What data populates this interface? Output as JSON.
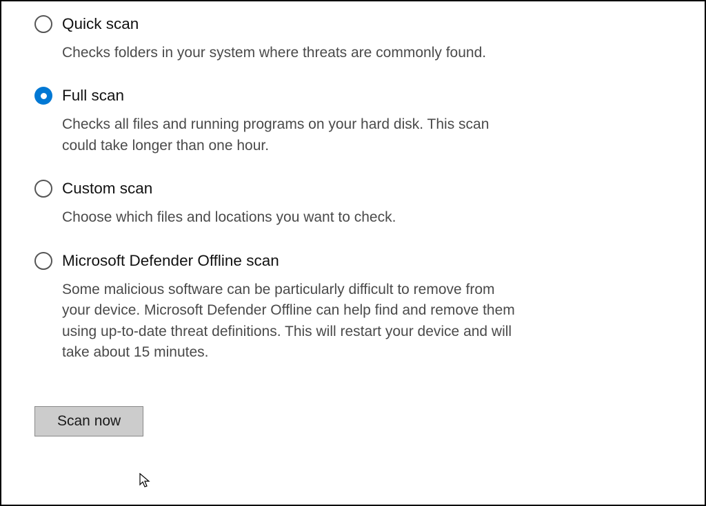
{
  "options": [
    {
      "title": "Quick scan",
      "description": "Checks folders in your system where threats are commonly found.",
      "selected": false
    },
    {
      "title": "Full scan",
      "description": "Checks all files and running programs on your hard disk. This scan could take longer than one hour.",
      "selected": true
    },
    {
      "title": "Custom scan",
      "description": "Choose which files and locations you want to check.",
      "selected": false
    },
    {
      "title": "Microsoft Defender Offline scan",
      "description": "Some malicious software can be particularly difficult to remove from your device. Microsoft Defender Offline can help find and remove them using up-to-date threat definitions. This will restart your device and will take about 15 minutes.",
      "selected": false
    }
  ],
  "button": {
    "scan_now": "Scan now"
  },
  "colors": {
    "accent": "#0078d4"
  }
}
